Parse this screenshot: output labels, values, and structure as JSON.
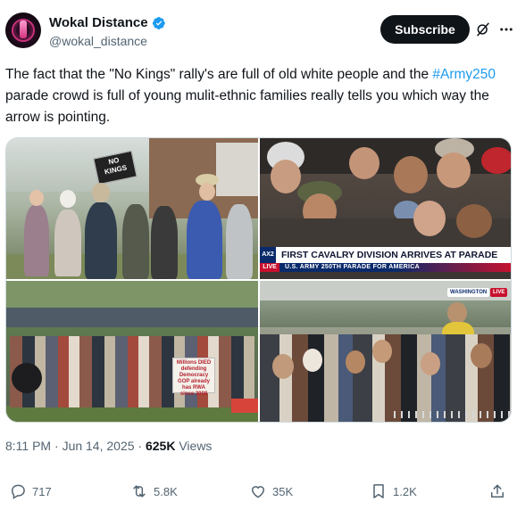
{
  "author": {
    "display_name": "Wokal Distance",
    "handle": "@wokal_distance",
    "verified": true
  },
  "header_actions": {
    "subscribe_label": "Subscribe",
    "grok_icon": "grok-icon",
    "more_icon": "more-icon"
  },
  "tweet": {
    "text_part1": "The fact that the \"No Kings\" rally's are full of old white people and the ",
    "hashtag": "#Army250",
    "text_part2": " parade crowd is full of young mulit-ethnic families really tells you which way the arrow is pointing."
  },
  "media": {
    "photo1_sign": "NO KINGS",
    "photo2_chyron_tag": "AX2",
    "photo2_chyron_title": "FIRST CAVALRY DIVISION ARRIVES AT PARADE",
    "photo2_chyron_live": "LIVE",
    "photo2_chyron_sub": "U.S. ARMY 250TH PARADE FOR AMERICA",
    "photo3_sign": "Millions DIED defending Democracy GOP already has RWA since 2008",
    "photo4_badge": "WASHINGTON",
    "photo4_live": "LIVE"
  },
  "meta": {
    "time": "8:11 PM",
    "date": "Jun 14, 2025",
    "views_count": "625K",
    "views_label": "Views"
  },
  "engagement": {
    "replies": "717",
    "reposts": "5.8K",
    "likes": "35K",
    "bookmarks": "1.2K"
  },
  "colors": {
    "accent": "#1d9bf0",
    "text": "#0f1419",
    "secondary": "#536471"
  }
}
